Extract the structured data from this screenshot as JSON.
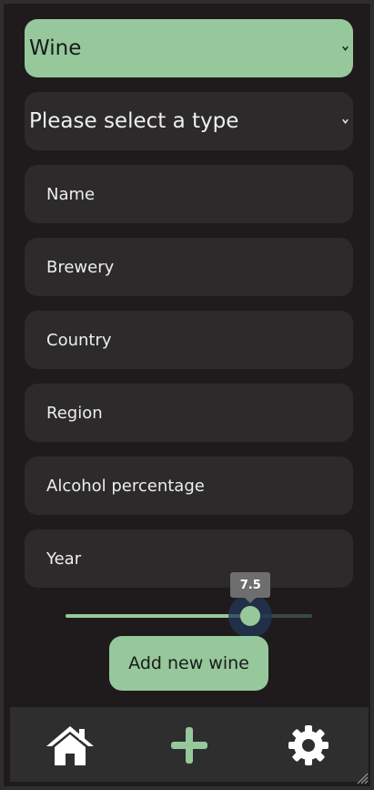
{
  "form": {
    "category_select": {
      "value": "Wine"
    },
    "type_select": {
      "value": "Please select a type"
    },
    "fields": {
      "name": "Name",
      "brewery": "Brewery",
      "country": "Country",
      "region": "Region",
      "alcohol": "Alcohol percentage",
      "year": "Year"
    },
    "rating_slider": {
      "value": "7.5",
      "min": 0,
      "max": 10,
      "fraction": 0.75
    },
    "submit_label": "Add new wine"
  },
  "nav": {
    "items": [
      {
        "icon": "home-icon"
      },
      {
        "icon": "plus-icon"
      },
      {
        "icon": "gear-icon"
      }
    ]
  },
  "colors": {
    "accent": "#96c89c",
    "background": "#1f1b1c",
    "field": "#2c2a2b",
    "navbar": "#2e2e2e"
  }
}
